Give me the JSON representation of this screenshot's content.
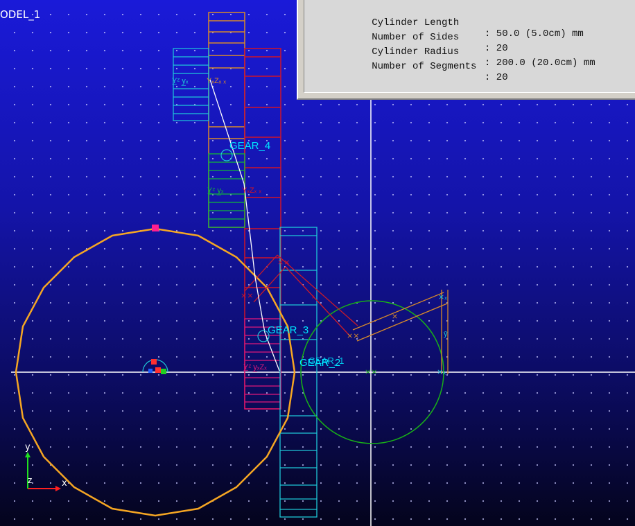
{
  "viewport": {
    "model_label": "ODEL_1",
    "axis_x_label": "x",
    "axis_y_label": "y",
    "axis_z_label": "z"
  },
  "gears": [
    {
      "label": "GEAR_4",
      "color": "#00e5ff"
    },
    {
      "label": "GEAR_3",
      "color": "#00e5ff"
    },
    {
      "label": "GEAR_2",
      "color": "#00e5ff"
    },
    {
      "label": "GEAR_1",
      "color": "#00e5ff"
    }
  ],
  "info_panel": {
    "rows": [
      {
        "label": "Cylinder Length",
        "value": ": 50.0 (5.0cm) mm"
      },
      {
        "label": "Number of Sides",
        "value": ": 20"
      },
      {
        "label": "Cylinder Radius",
        "value": ": 200.0 (20.0cm) mm"
      },
      {
        "label": "Number of Segments",
        "value": ": 20"
      }
    ]
  },
  "colors": {
    "background_top": "#1a1ad8",
    "background_bottom": "#04041c",
    "orange_cylinder": "#f5a623",
    "green_circle": "#1ab01a",
    "selection_marker": "#ff1f8f",
    "panel_bg": "#d4d0c8"
  }
}
